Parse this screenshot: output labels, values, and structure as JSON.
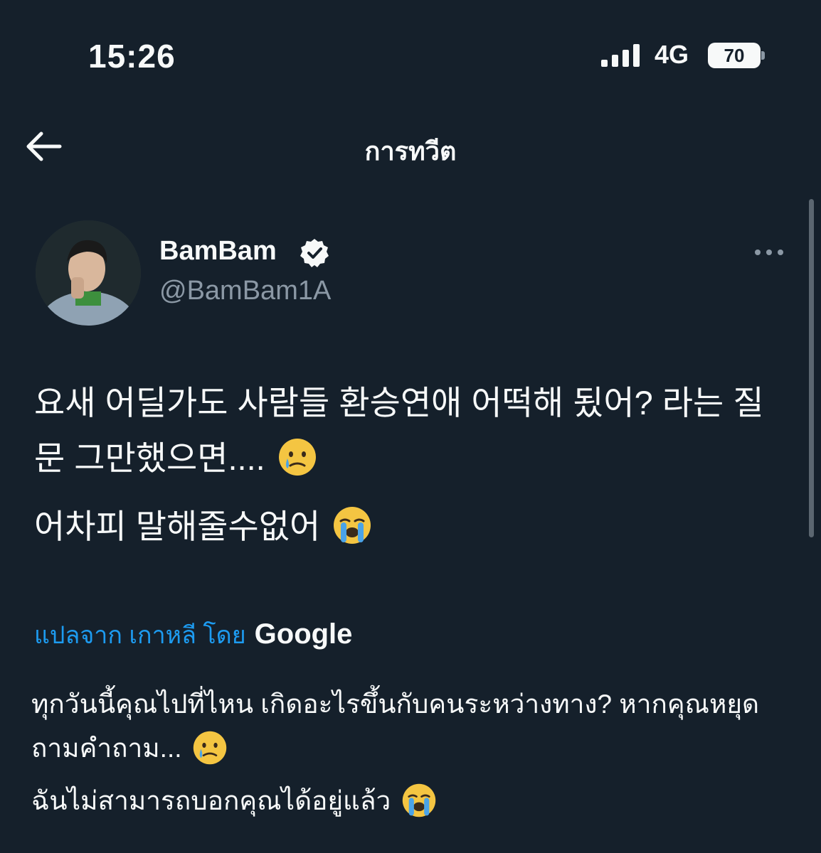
{
  "status_bar": {
    "time": "15:26",
    "network": "4G",
    "battery": "70"
  },
  "header": {
    "title": "การทวีต"
  },
  "tweet": {
    "display_name": "BamBam",
    "handle": "@BamBam1A",
    "text_line_1": "요새 어딜가도 사람들 환승연애 어떡해 됬어? 라는 질문 그만했으면....",
    "text_line_2": "어차피 말해줄수없어",
    "translation_label": "แปลจาก เกาหลี โดย",
    "translation_provider": "Google",
    "translated_line_1": "ทุกวันนี้คุณไปที่ไหน เกิดอะไรขึ้นกับคนระหว่างทาง? หากคุณหยุดถามคำถาม...",
    "translated_line_2": "ฉันไม่สามารถบอกคุณได้อยู่แล้ว"
  },
  "icons": {
    "back": "arrow-left-icon",
    "verified": "verified-badge-icon",
    "more": "more-horizontal-icon",
    "emoji_1": "face-holding-back-tears-emoji",
    "emoji_2": "loudly-crying-face-emoji"
  },
  "colors": {
    "background": "#15202b",
    "accent": "#1d9bf0",
    "text": "#f7f9f9",
    "secondary_text": "#8b98a5"
  }
}
